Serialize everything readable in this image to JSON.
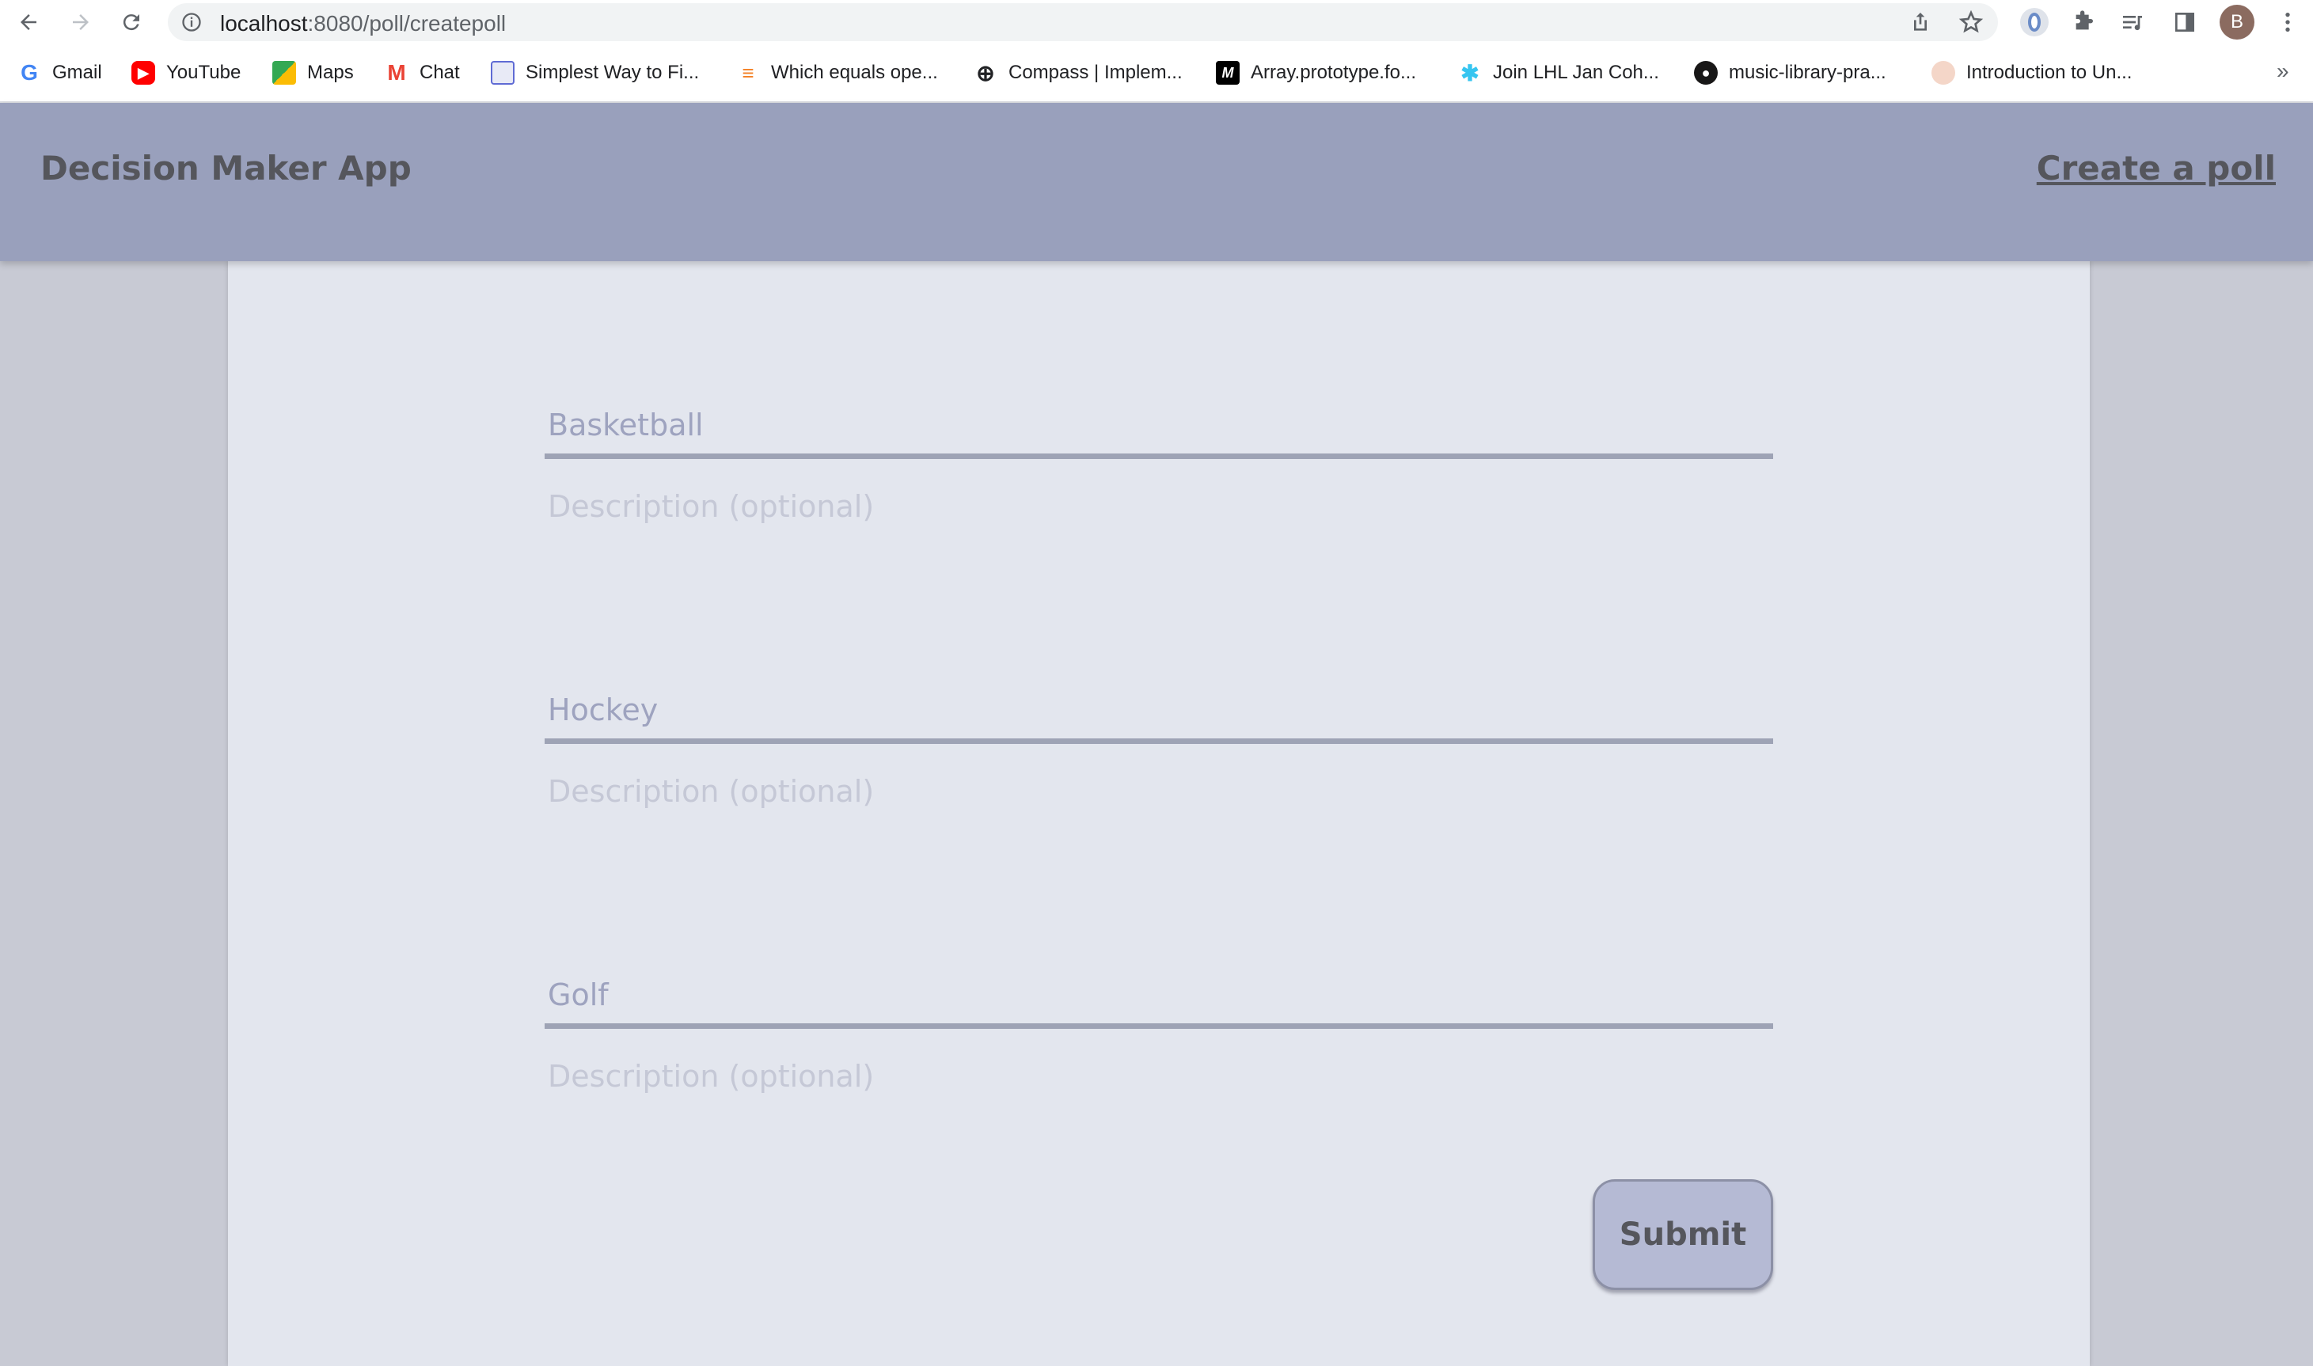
{
  "browser": {
    "url_host": "localhost",
    "url_path": ":8080/poll/createpoll",
    "profile_initial": "B",
    "bookmarks": [
      {
        "label": "Gmail",
        "icon": "google-icon",
        "color": "#4285f4"
      },
      {
        "label": "YouTube",
        "icon": "youtube-icon",
        "color": "#ff0000"
      },
      {
        "label": "Maps",
        "icon": "maps-icon",
        "color": "#34a853"
      },
      {
        "label": "Chat",
        "icon": "gmail-icon",
        "color": "#ea4335"
      },
      {
        "label": "Simplest Way to Fi...",
        "icon": "page-icon",
        "color": "#5f6bd4"
      },
      {
        "label": "Which equals ope...",
        "icon": "stackoverflow-icon",
        "color": "#f48024"
      },
      {
        "label": "Compass | Implem...",
        "icon": "compass-icon",
        "color": "#202124"
      },
      {
        "label": "Array.prototype.fo...",
        "icon": "mdn-icon",
        "color": "#000000"
      },
      {
        "label": "Join LHL Jan Coh...",
        "icon": "slack-icon",
        "color": "#36c5f0"
      },
      {
        "label": "music-library-pra...",
        "icon": "github-icon",
        "color": "#181717"
      },
      {
        "label": "Introduction to Un...",
        "icon": "avatar-icon",
        "color": "#e8a0a0"
      }
    ],
    "more_bookmarks": "»"
  },
  "header": {
    "brand": "Decision Maker App",
    "create_link": "Create a poll"
  },
  "options": [
    {
      "title_placeholder": "Basketball",
      "description_placeholder": "Description (optional)"
    },
    {
      "title_placeholder": "Hockey",
      "description_placeholder": "Description (optional)"
    },
    {
      "title_placeholder": "Golf",
      "description_placeholder": "Description (optional)"
    }
  ],
  "form": {
    "submit_label": "Submit"
  }
}
